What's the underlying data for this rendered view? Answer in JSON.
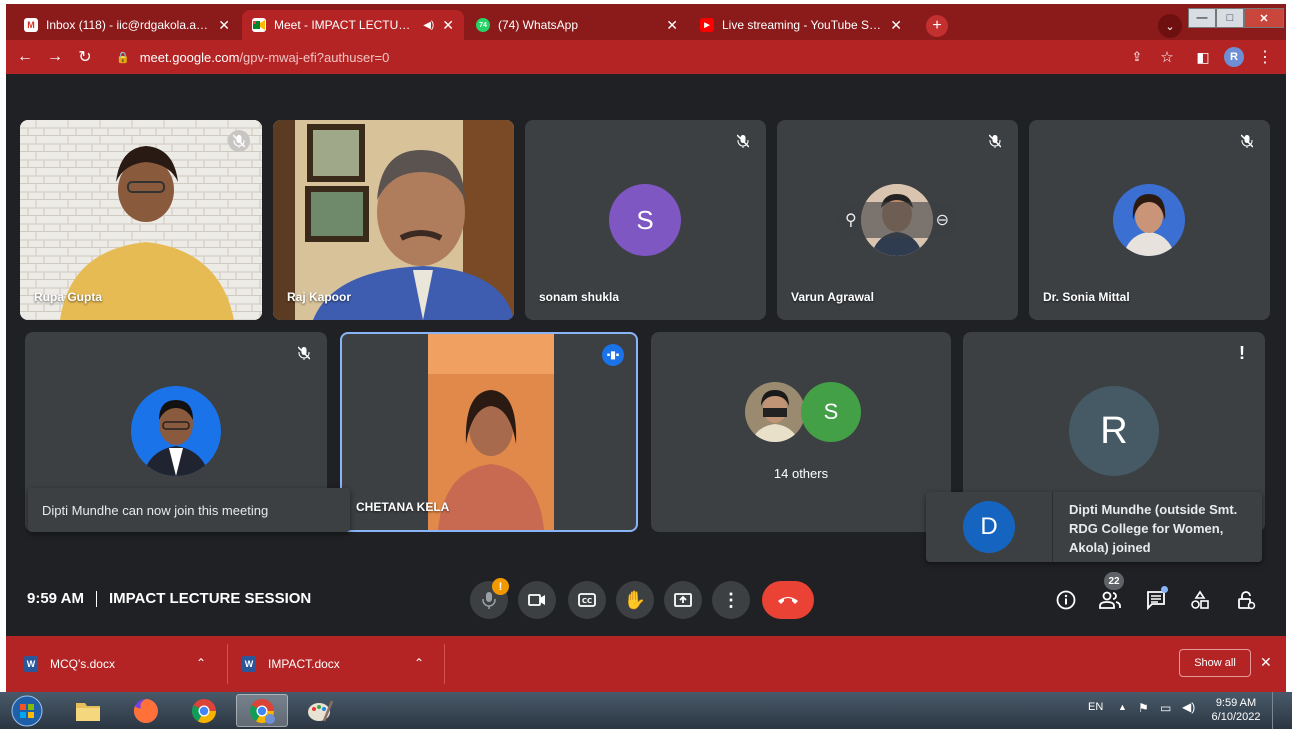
{
  "browser": {
    "tabs": [
      {
        "favicon": "gmail-icon",
        "title": "Inbox (118) - iic@rdgakola.ac.in - "
      },
      {
        "favicon": "meet-icon",
        "title": "Meet - IMPACT LECTURE SESS"
      },
      {
        "favicon": "whatsapp-icon",
        "title": "(74) WhatsApp"
      },
      {
        "favicon": "youtube-icon",
        "title": "Live streaming - YouTube Studio"
      }
    ],
    "whatsapp_badge": "74",
    "url_host": "meet.google.com",
    "url_path": "/gpv-mwaj-efi?authuser=0",
    "profile_initial": "R"
  },
  "meeting": {
    "participants": [
      {
        "name": "Rupa Gupta",
        "muted": true
      },
      {
        "name": "Raj Kapoor",
        "muted": false
      },
      {
        "name": "sonam shukla",
        "muted": true,
        "initial": "S"
      },
      {
        "name": "Varun Agrawal",
        "muted": true
      },
      {
        "name": "Dr. Sonia Mittal",
        "muted": true
      },
      {
        "name": "Dipti Mundhe",
        "muted": true
      },
      {
        "name": "CHETANA KELA",
        "speaking": true
      },
      {
        "name": "14 others",
        "initial": "S"
      },
      {
        "name": "R",
        "initial": "R"
      }
    ],
    "toast_left": "Dipti Mundhe can now join this meeting",
    "toast_right": "Dipti Mundhe (outside Smt. RDG College for Women, Akola) joined",
    "toast_right_initial": "D",
    "time": "9:59 AM",
    "title": "IMPACT LECTURE SESSION",
    "people_count": "22",
    "mic_alert": "!"
  },
  "downloads": {
    "items": [
      "MCQ's.docx",
      "IMPACT.docx"
    ],
    "show_all": "Show all"
  },
  "taskbar": {
    "lang": "EN",
    "time": "9:59 AM",
    "date": "6/10/2022"
  },
  "colors": {
    "chrome_dark": "#8b1a1a",
    "chrome": "#b52424",
    "meet_bg": "#202124",
    "tile_bg": "#3c4043",
    "speaking_border": "#8ab4f8",
    "end_call": "#ea4335"
  }
}
